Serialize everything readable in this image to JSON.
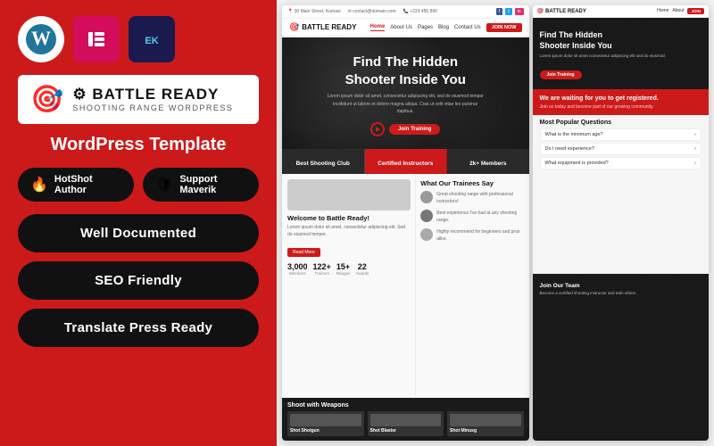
{
  "left": {
    "icons": [
      {
        "name": "wordpress",
        "symbol": "W",
        "bg": "#fff",
        "color": "#21759b"
      },
      {
        "name": "elementor",
        "symbol": "≡",
        "bg": "#d30c5c",
        "color": "#fff"
      },
      {
        "name": "envatokit",
        "symbol": "EK",
        "bg": "#2d2d6e",
        "color": "#4dd0e1"
      }
    ],
    "logo": {
      "main": "BATTLE READY",
      "sub": "SHOOTING RANGE WORDPRESS"
    },
    "template_label": "WordPress Template",
    "badges": [
      {
        "icon": "🔥",
        "label": "HotShot Author"
      },
      {
        "icon": "🛡",
        "label": "Support Maverik"
      }
    ],
    "features": [
      "Well Documented",
      "SEO Friendly",
      "Translate Press Ready"
    ]
  },
  "right": {
    "nav": {
      "logo": "⚙ BATTLE READY",
      "items": [
        "Home",
        "About Us",
        "Pages",
        "Blog",
        "Contact Us"
      ],
      "active": "Home",
      "cta": "JOIN NOW"
    },
    "hero": {
      "title": "Find The Hidden\nShooter Inside You",
      "subtitle": "Lorem ipsum dolor sit amet, consectetur adipiscing elit, sed do eiusmod tempor incididunt ut labore et dolore magna aliqua. Cras ut velit vitae leo pulvinar dapibus.",
      "cta": "Join Training"
    },
    "stats_bar": [
      {
        "label": "Best Shooting Club",
        "active": false
      },
      {
        "label": "Certified Instructors",
        "active": true
      },
      {
        "label": "2k+ Members",
        "active": false
      }
    ],
    "content_left": {
      "title": "Welcome to Battle Ready!",
      "text": "Lorem ipsum dolor sit amet, consectetur adipiscing elit. Sed do eiusmod tempor.",
      "stats": [
        {
          "num": "3,000",
          "label": "Members"
        },
        {
          "num": "122+",
          "label": "Trainers"
        },
        {
          "num": "15+",
          "label": "Ranges"
        },
        {
          "num": "22",
          "label": "Awards"
        }
      ]
    },
    "content_right": {
      "title": "What Our Trainees Say",
      "reviews": [
        {
          "text": "Great shooting range with professional instructors!"
        },
        {
          "text": "Best experience I've had at any shooting range."
        },
        {
          "text": "Highly recommend for beginners and pros alike."
        }
      ]
    },
    "bottom_section": {
      "left": {
        "title": "We are waiting for you\nto get registered.",
        "text": "Join us today and become part of our growing community."
      },
      "right": {
        "title": "Most Popular Questions",
        "faqs": [
          "What is the minimum age?",
          "Do I need experience?",
          "What equipment is provided?"
        ]
      }
    },
    "weapons": {
      "title": "Shoot with Weapons",
      "items": [
        {
          "name": "Shot Shotgun"
        },
        {
          "name": "Shot Blaster"
        },
        {
          "name": "Shot Minusg"
        }
      ]
    }
  }
}
